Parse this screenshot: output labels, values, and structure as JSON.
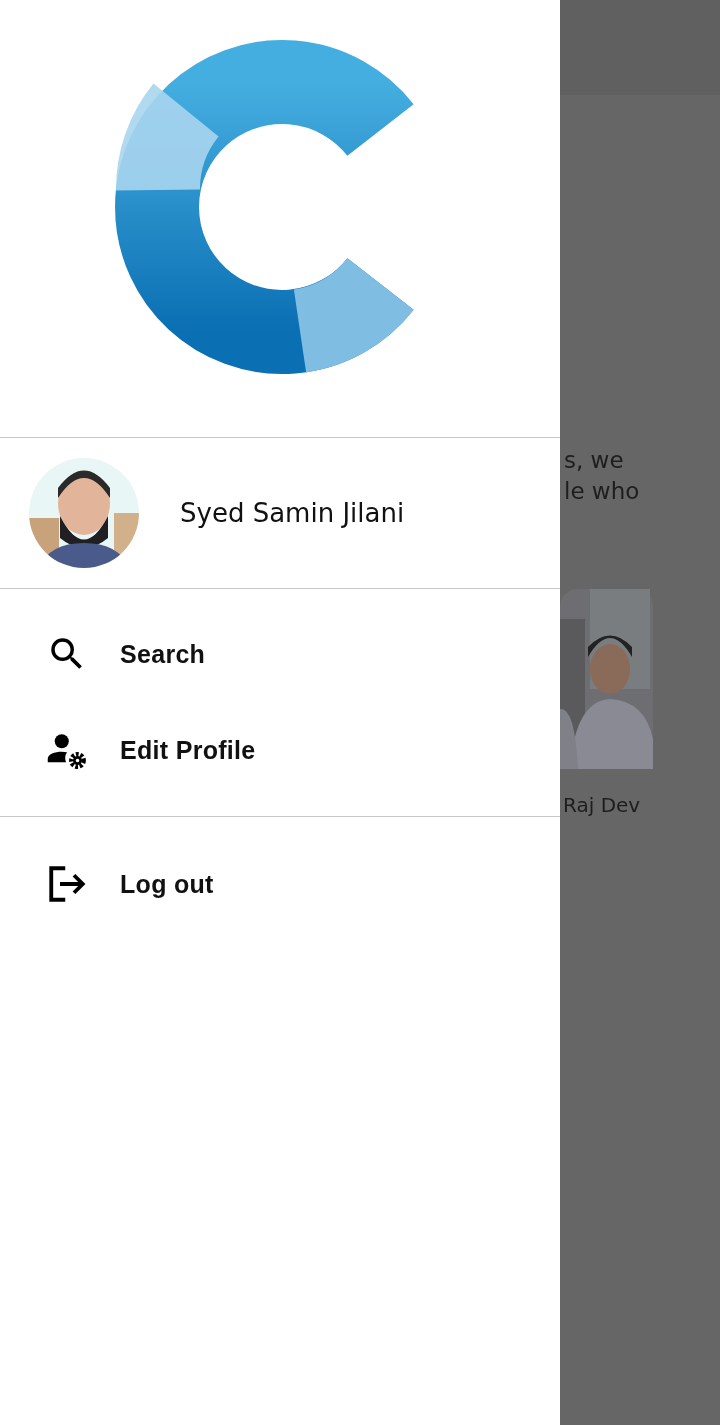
{
  "drawer": {
    "profile": {
      "name": "Syed Samin Jilani"
    },
    "menu_sections": [
      [
        {
          "label": "Search"
        },
        {
          "label": "Edit Profile"
        }
      ],
      [
        {
          "label": "Log out"
        }
      ]
    ]
  },
  "background": {
    "text_lines": [
      "s, we",
      "le who"
    ],
    "card": {
      "name": "Raj Dev"
    }
  }
}
